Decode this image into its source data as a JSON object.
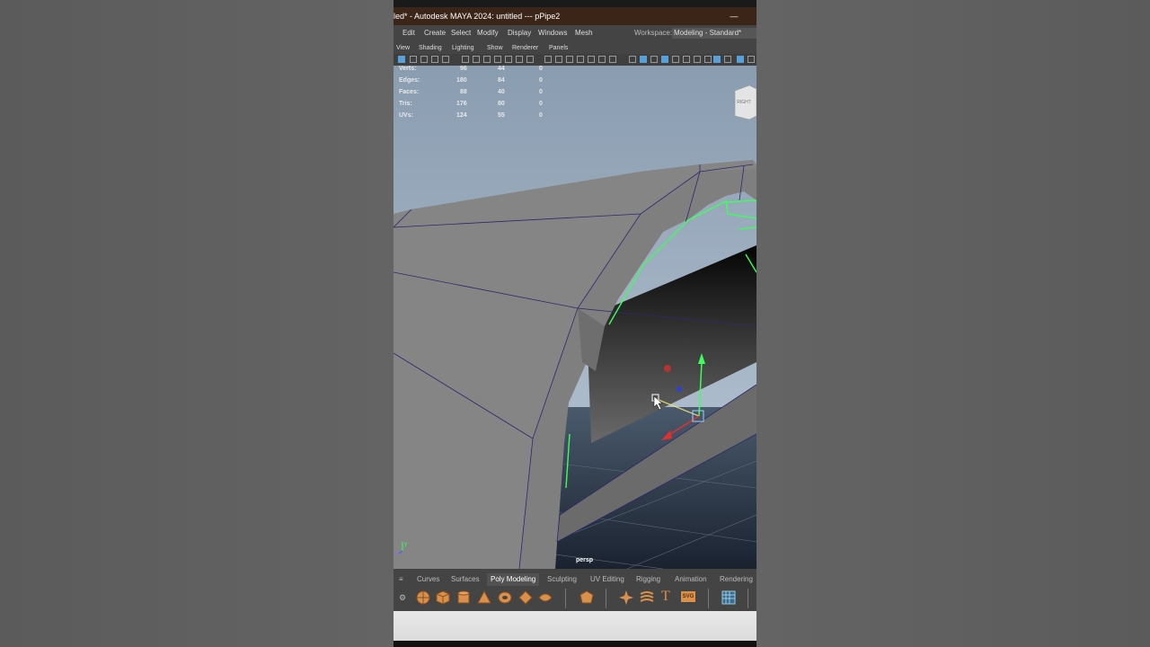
{
  "titlebar": {
    "title": "led* - Autodesk MAYA 2024: untitled   ---   pPipe2",
    "minimize": "—"
  },
  "menubar": {
    "items": [
      "Edit",
      "Create",
      "Select",
      "Modify",
      "Display",
      "Windows",
      "Mesh"
    ],
    "workspace_label": "Workspace:",
    "workspace_value": "Modeling - Standard*"
  },
  "panel_menu": {
    "items": [
      "View",
      "Shading",
      "Lighting",
      "Show",
      "Renderer",
      "Panels"
    ]
  },
  "hud": {
    "rows": [
      {
        "label": "Verts:",
        "a": "96",
        "b": "44",
        "c": "0"
      },
      {
        "label": "Edges:",
        "a": "180",
        "b": "84",
        "c": "0"
      },
      {
        "label": "Faces:",
        "a": "88",
        "b": "40",
        "c": "0"
      },
      {
        "label": "Tris:",
        "a": "176",
        "b": "80",
        "c": "0"
      },
      {
        "label": "UVs:",
        "a": "124",
        "b": "55",
        "c": "0"
      }
    ]
  },
  "viewport": {
    "camera_label": "persp",
    "view_cube_label": "RIGHT",
    "axis_y": "y",
    "axis_z": "z",
    "colors": {
      "sky_top": "#8a9cb0",
      "sky_bottom": "#b8c6d4",
      "selection": "#3cff5a",
      "wire": "#2a2a6a"
    }
  },
  "shelf": {
    "tabs": [
      "Curves",
      "Surfaces",
      "Poly Modeling",
      "Sculpting",
      "UV Editing",
      "Rigging",
      "Animation",
      "Rendering"
    ],
    "active_tab": "Poly Modeling",
    "text_tool": "T",
    "svg_tool": "SVG",
    "icons": [
      "sphere-icon",
      "cube-icon",
      "cylinder-icon",
      "cone-icon",
      "torus-icon",
      "plane-icon",
      "disc-icon",
      "platonic-icon",
      "sweep-icon",
      "mesh-icon",
      "text-icon",
      "svg-icon",
      "uv-grid-icon"
    ]
  }
}
